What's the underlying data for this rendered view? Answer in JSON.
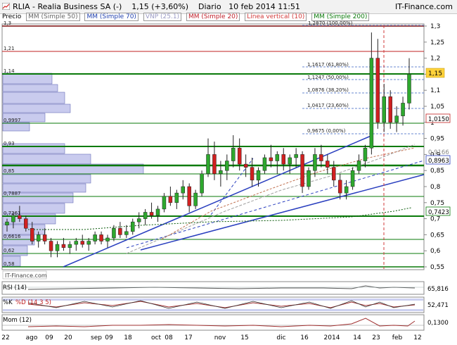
{
  "header": {
    "symbol": "RLIA - Realia Business SA (-)",
    "change": "1,15 (+3,60%)",
    "period": "Diario",
    "datetime": "10 feb 2014 11:51",
    "brand": "IT-Finance.com"
  },
  "legend": {
    "precio": "Precio",
    "items": [
      {
        "label": "MM (Simple 50)",
        "color": "#888888"
      },
      {
        "label": "MM (Simple 70)",
        "color": "#1f3fae"
      },
      {
        "label": "VNP (25.1)",
        "color": "#b8b8d8"
      },
      {
        "label": "MM (Simple 20)",
        "color": "#c0202a"
      },
      {
        "label": "Línea vertical (10)",
        "color": "#d23a3a"
      },
      {
        "label": "MM (Simple 200)",
        "color": "#0a7a0a"
      }
    ]
  },
  "axis": {
    "price_labels": [
      "1,3",
      "1,25",
      "1,2",
      "1,15",
      "1,1",
      "1,05",
      "1",
      "0,95",
      "0,9",
      "0,85",
      "0,8",
      "0,75",
      "0,7",
      "0,65",
      "0,6",
      "0,55"
    ],
    "x_labels": [
      "22",
      "ago",
      "09",
      "20",
      "sep",
      "09",
      "18",
      "oct",
      "08",
      "17",
      "nov",
      "15",
      "dic",
      "16",
      "2014",
      "14",
      "23",
      "feb",
      "12"
    ]
  },
  "level_labels": {
    "left": [
      "1,3",
      "1,21",
      "1,14",
      "0,9997",
      "0,93",
      "0,85",
      "0,7887",
      "0,7261",
      "0,6616",
      "0,62",
      "0,58"
    ],
    "fib": [
      "1,2870 (100,00%)",
      "1,1617 (61,80%)",
      "1,1247 (50,00%)",
      "1,0876 (38,20%)",
      "1,0417 (23,60%)",
      "0,9675 (0,00%)"
    ]
  },
  "right_badges": {
    "price": "1,15",
    "v1": "1,0150",
    "v2": "0,9166",
    "v3": "0,8963",
    "v4": "0,7423"
  },
  "footer": {
    "brand": "IT-Finance.com"
  },
  "indicators": {
    "rsi": {
      "label": "RSI (14)",
      "value": "65,816"
    },
    "stoch": {
      "label": "%K",
      "label2": "%D (14 3 5)",
      "value": "52,471"
    },
    "mom": {
      "label": "Mom (12)",
      "value": "0,1300"
    }
  },
  "colors": {
    "up": "#2ea82e",
    "down": "#d02020",
    "support": "#0a7a0a",
    "resistance": "#c02020",
    "trend": "#2a3fbf",
    "badge": "#ffd23a"
  },
  "chart_data": {
    "type": "candlestick",
    "ylim": [
      0.55,
      1.3
    ],
    "price_levels": [
      1.3,
      1.21,
      1.14,
      0.9997,
      0.93,
      0.85,
      0.7887,
      0.7261,
      0.6616,
      0.62,
      0.58
    ],
    "fibonacci": [
      1.287,
      1.1617,
      1.1247,
      1.0876,
      1.0417,
      0.9675
    ],
    "last_price": 1.15,
    "ohlc_approx": [
      [
        0.68,
        0.7,
        0.66,
        0.69
      ],
      [
        0.69,
        0.72,
        0.67,
        0.71
      ],
      [
        0.71,
        0.74,
        0.69,
        0.7
      ],
      [
        0.7,
        0.71,
        0.66,
        0.67
      ],
      [
        0.67,
        0.69,
        0.62,
        0.63
      ],
      [
        0.63,
        0.66,
        0.61,
        0.65
      ],
      [
        0.65,
        0.67,
        0.62,
        0.63
      ],
      [
        0.63,
        0.64,
        0.58,
        0.6
      ],
      [
        0.6,
        0.63,
        0.58,
        0.62
      ],
      [
        0.62,
        0.64,
        0.6,
        0.61
      ],
      [
        0.61,
        0.63,
        0.59,
        0.62
      ],
      [
        0.62,
        0.64,
        0.6,
        0.63
      ],
      [
        0.63,
        0.65,
        0.61,
        0.62
      ],
      [
        0.62,
        0.64,
        0.6,
        0.63
      ],
      [
        0.63,
        0.66,
        0.62,
        0.65
      ],
      [
        0.65,
        0.66,
        0.62,
        0.63
      ],
      [
        0.63,
        0.65,
        0.61,
        0.64
      ],
      [
        0.64,
        0.68,
        0.63,
        0.67
      ],
      [
        0.67,
        0.69,
        0.64,
        0.65
      ],
      [
        0.65,
        0.68,
        0.64,
        0.66
      ],
      [
        0.66,
        0.7,
        0.65,
        0.69
      ],
      [
        0.69,
        0.72,
        0.67,
        0.7
      ],
      [
        0.7,
        0.73,
        0.68,
        0.72
      ],
      [
        0.72,
        0.75,
        0.7,
        0.71
      ],
      [
        0.71,
        0.74,
        0.69,
        0.73
      ],
      [
        0.73,
        0.78,
        0.72,
        0.77
      ],
      [
        0.77,
        0.8,
        0.74,
        0.75
      ],
      [
        0.75,
        0.79,
        0.73,
        0.78
      ],
      [
        0.78,
        0.82,
        0.76,
        0.8
      ],
      [
        0.8,
        0.81,
        0.72,
        0.74
      ],
      [
        0.74,
        0.79,
        0.73,
        0.78
      ],
      [
        0.78,
        0.85,
        0.77,
        0.84
      ],
      [
        0.84,
        0.95,
        0.83,
        0.9
      ],
      [
        0.9,
        0.94,
        0.82,
        0.84
      ],
      [
        0.84,
        0.88,
        0.8,
        0.85
      ],
      [
        0.85,
        0.9,
        0.82,
        0.88
      ],
      [
        0.88,
        0.96,
        0.86,
        0.92
      ],
      [
        0.92,
        0.95,
        0.85,
        0.87
      ],
      [
        0.87,
        0.9,
        0.83,
        0.86
      ],
      [
        0.86,
        0.89,
        0.8,
        0.82
      ],
      [
        0.82,
        0.86,
        0.8,
        0.85
      ],
      [
        0.85,
        0.9,
        0.84,
        0.89
      ],
      [
        0.89,
        0.93,
        0.86,
        0.88
      ],
      [
        0.88,
        0.91,
        0.84,
        0.9
      ],
      [
        0.9,
        0.92,
        0.85,
        0.87
      ],
      [
        0.87,
        0.9,
        0.84,
        0.89
      ],
      [
        0.89,
        0.92,
        0.86,
        0.9
      ],
      [
        0.9,
        0.91,
        0.78,
        0.8
      ],
      [
        0.8,
        0.86,
        0.79,
        0.85
      ],
      [
        0.85,
        0.92,
        0.83,
        0.9
      ],
      [
        0.9,
        0.93,
        0.86,
        0.88
      ],
      [
        0.88,
        0.9,
        0.84,
        0.86
      ],
      [
        0.86,
        0.88,
        0.8,
        0.82
      ],
      [
        0.82,
        0.84,
        0.76,
        0.78
      ],
      [
        0.78,
        0.82,
        0.76,
        0.8
      ],
      [
        0.8,
        0.86,
        0.79,
        0.85
      ],
      [
        0.85,
        0.9,
        0.84,
        0.88
      ],
      [
        0.88,
        0.93,
        0.86,
        0.92
      ],
      [
        0.92,
        1.28,
        0.9,
        1.2
      ],
      [
        1.2,
        1.26,
        0.98,
        1.0
      ],
      [
        1.0,
        1.12,
        0.97,
        1.08
      ],
      [
        1.08,
        1.1,
        0.98,
        1.0
      ],
      [
        1.0,
        1.05,
        0.97,
        1.02
      ],
      [
        1.02,
        1.08,
        0.99,
        1.06
      ],
      [
        1.06,
        1.2,
        1.04,
        1.15
      ]
    ]
  }
}
